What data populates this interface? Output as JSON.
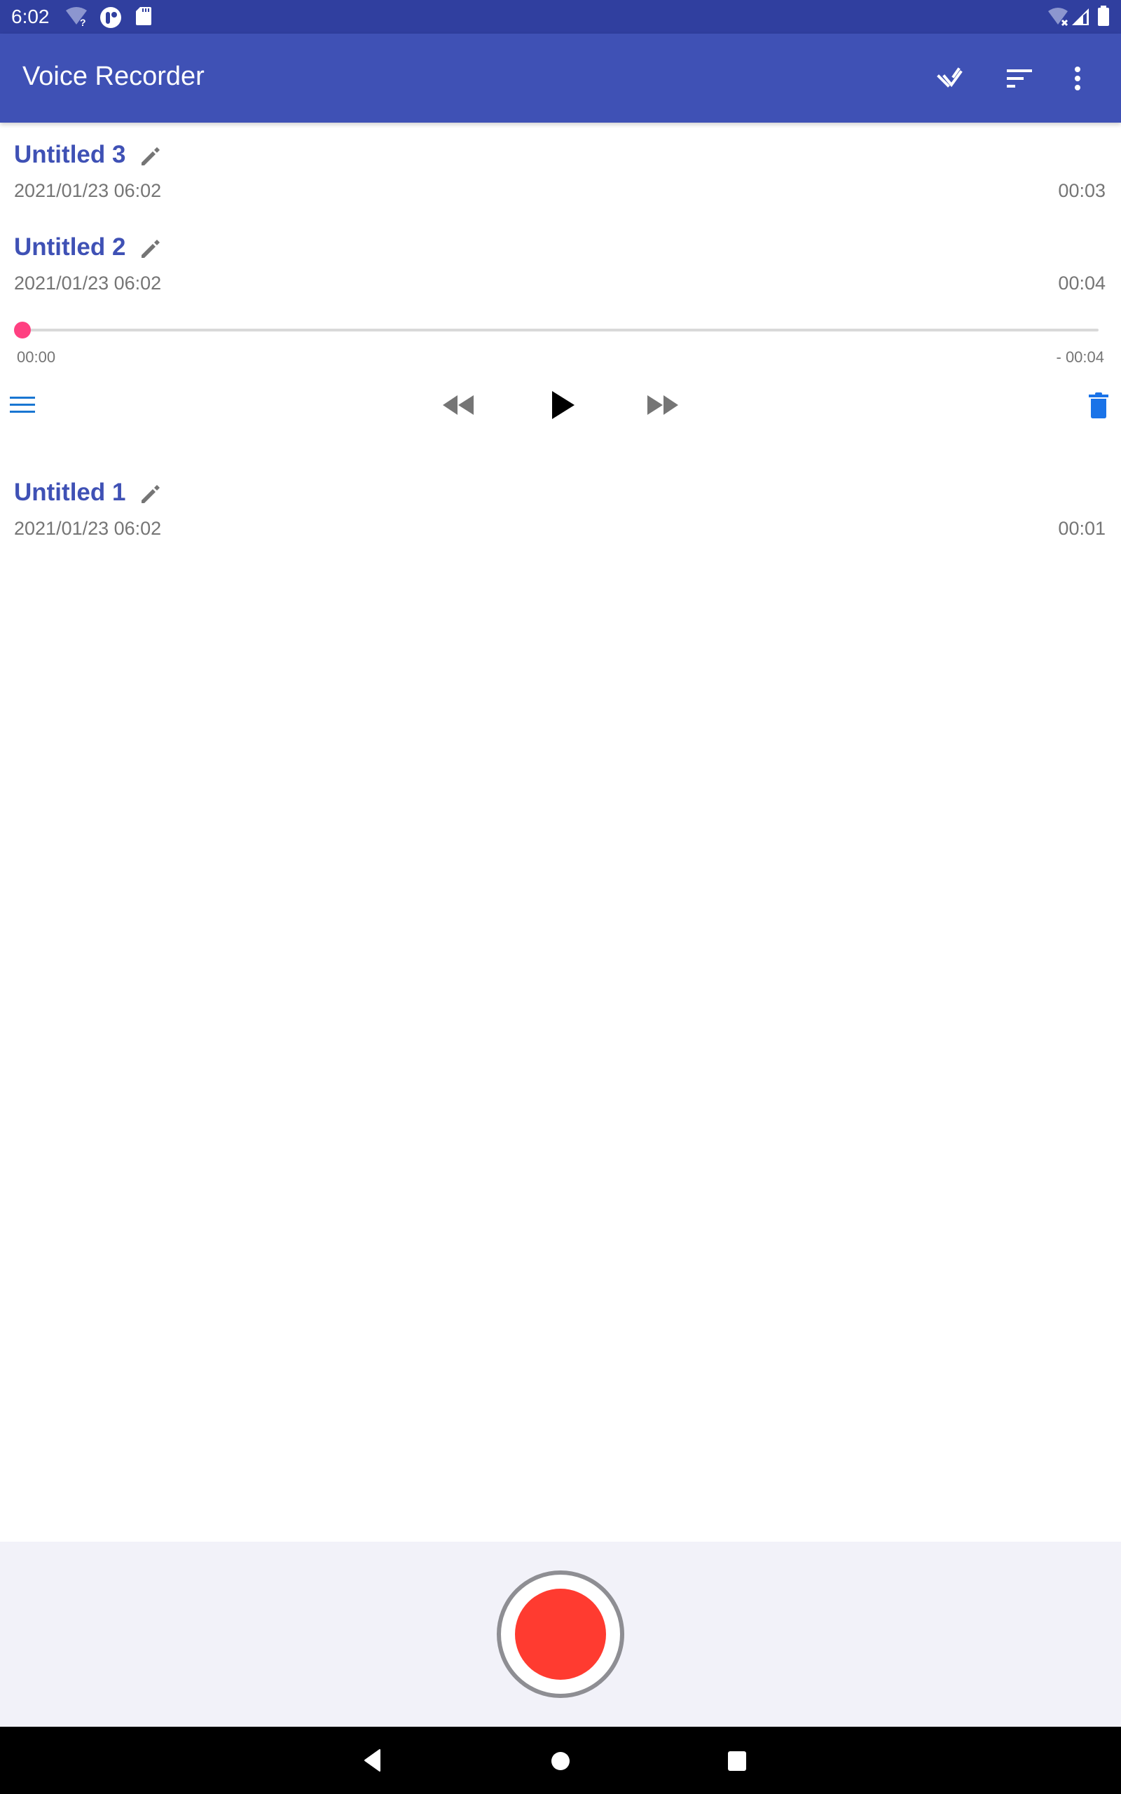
{
  "status_bar": {
    "time": "6:02",
    "left_icons": [
      "wifi-unknown-icon",
      "app-notification-icon",
      "sd-card-icon"
    ],
    "right_icons": [
      "wifi-off-icon",
      "cell-signal-icon",
      "battery-full-icon"
    ]
  },
  "toolbar": {
    "title": "Voice Recorder",
    "actions": [
      "select-all-icon",
      "sort-icon",
      "more-options-icon"
    ]
  },
  "colors": {
    "status_bar": "#303f9f",
    "toolbar": "#3f51b5",
    "title_text": "#3f51b5",
    "secondary_text": "#757575",
    "seek_accent": "#ff4081",
    "action_blue": "#1a73e8",
    "record_red": "#ff3b30",
    "bottom_panel": "#f2f2f9"
  },
  "recordings": [
    {
      "title": "Untitled 3",
      "date": "2021/01/23 06:02",
      "duration": "00:03"
    },
    {
      "title": "Untitled 2",
      "date": "2021/01/23 06:02",
      "duration": "00:04"
    },
    {
      "title": "Untitled 1",
      "date": "2021/01/23 06:02",
      "duration": "00:01"
    }
  ],
  "player": {
    "expanded_for": "Untitled 2",
    "elapsed": "00:00",
    "remaining": "- 00:04",
    "progress_fraction": 0.0,
    "controls": [
      "menu-icon",
      "rewind-icon",
      "play-icon",
      "fast-forward-icon",
      "delete-icon"
    ]
  },
  "bottom": {
    "record_button": "record-icon"
  },
  "nav_bar": {
    "buttons": [
      "back-icon",
      "home-icon",
      "recents-icon"
    ]
  }
}
